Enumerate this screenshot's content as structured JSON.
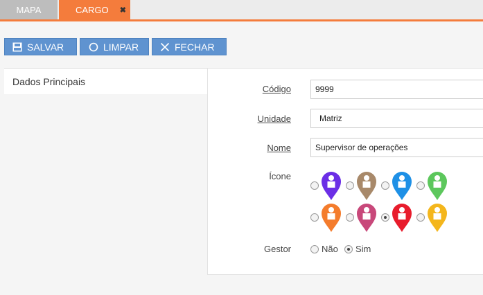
{
  "tabs": [
    {
      "label": "MAPA"
    },
    {
      "label": "CARGO",
      "close": "✖"
    }
  ],
  "toolbar": {
    "salvar": "SALVAR",
    "limpar": "LIMPAR",
    "fechar": "FECHAR"
  },
  "side": {
    "dados_principais": "Dados Principais"
  },
  "form": {
    "codigo_label": "Código",
    "codigo_value": "9999",
    "unidade_label": "Unidade",
    "unidade_value": "Matriz",
    "nome_label": "Nome",
    "nome_value": "Supervisor de operações",
    "icone_label": "Ícone",
    "icons": [
      {
        "name": "purple-pin",
        "color": "#6b2ee6",
        "selected": false
      },
      {
        "name": "brown-pin",
        "color": "#a8896a",
        "selected": false
      },
      {
        "name": "blue-pin",
        "color": "#1e90e6",
        "selected": false
      },
      {
        "name": "green-pin",
        "color": "#5cc75c",
        "selected": false
      },
      {
        "name": "orange-pin",
        "color": "#f47c2c",
        "selected": false
      },
      {
        "name": "pink-pin",
        "color": "#c8487a",
        "selected": false
      },
      {
        "name": "red-pin",
        "color": "#e81c2c",
        "selected": true
      },
      {
        "name": "yellow-pin",
        "color": "#f4b61c",
        "selected": false
      }
    ],
    "gestor_label": "Gestor",
    "gestor_nao": "Não",
    "gestor_sim": "Sim",
    "gestor_selected": "Sim"
  },
  "colors": {
    "accent": "#f47c3c",
    "button": "#5f93d0"
  }
}
